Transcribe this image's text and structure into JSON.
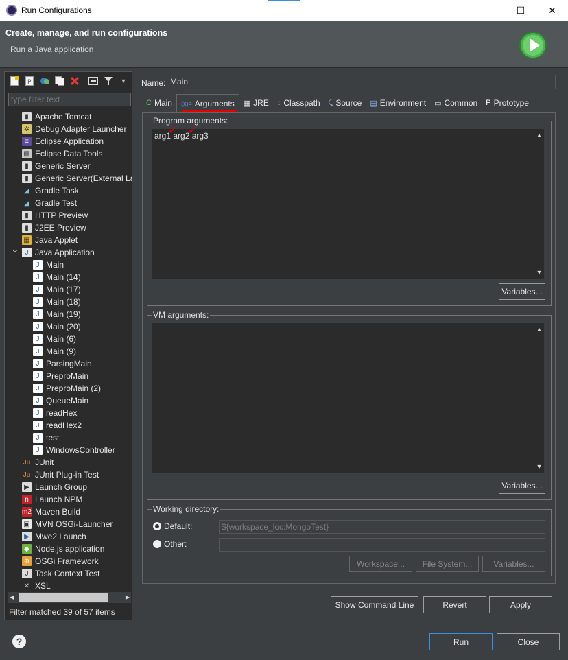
{
  "window": {
    "title": "Run Configurations",
    "minimize_glyph": "—",
    "maximize_glyph": "☐",
    "close_glyph": "✕"
  },
  "banner": {
    "title": "Create, manage, and run configurations",
    "subtitle": "Run a Java application"
  },
  "filter": {
    "placeholder": "type filter text"
  },
  "tree": [
    {
      "label": "Apache Tomcat",
      "icon": "tomcat-icon",
      "level": 0
    },
    {
      "label": "Debug Adapter Launcher",
      "icon": "debug-adapter-icon",
      "level": 0
    },
    {
      "label": "Eclipse Application",
      "icon": "eclipse-icon",
      "level": 0
    },
    {
      "label": "Eclipse Data Tools",
      "icon": "database-icon",
      "level": 0
    },
    {
      "label": "Generic Server",
      "icon": "server-icon",
      "level": 0
    },
    {
      "label": "Generic Server(External La",
      "icon": "server-icon",
      "level": 0
    },
    {
      "label": "Gradle Task",
      "icon": "gradle-icon",
      "level": 0
    },
    {
      "label": "Gradle Test",
      "icon": "gradle-icon",
      "level": 0
    },
    {
      "label": "HTTP Preview",
      "icon": "server-icon",
      "level": 0
    },
    {
      "label": "J2EE Preview",
      "icon": "server-icon",
      "level": 0
    },
    {
      "label": "Java Applet",
      "icon": "applet-icon",
      "level": 0
    },
    {
      "label": "Java Application",
      "icon": "java-app-icon",
      "level": 0,
      "expanded": true
    },
    {
      "label": "Main",
      "icon": "java-config-icon",
      "level": 1
    },
    {
      "label": "Main (14)",
      "icon": "java-config-icon",
      "level": 1
    },
    {
      "label": "Main (17)",
      "icon": "java-config-icon",
      "level": 1
    },
    {
      "label": "Main (18)",
      "icon": "java-config-icon",
      "level": 1
    },
    {
      "label": "Main (19)",
      "icon": "java-config-icon",
      "level": 1
    },
    {
      "label": "Main (20)",
      "icon": "java-config-icon",
      "level": 1
    },
    {
      "label": "Main (6)",
      "icon": "java-config-icon",
      "level": 1
    },
    {
      "label": "Main (9)",
      "icon": "java-config-icon",
      "level": 1
    },
    {
      "label": "ParsingMain",
      "icon": "java-config-icon",
      "level": 1
    },
    {
      "label": "PreproMain",
      "icon": "java-config-icon",
      "level": 1
    },
    {
      "label": "PreproMain (2)",
      "icon": "java-config-icon",
      "level": 1
    },
    {
      "label": "QueueMain",
      "icon": "java-config-icon",
      "level": 1
    },
    {
      "label": "readHex",
      "icon": "java-config-icon",
      "level": 1
    },
    {
      "label": "readHex2",
      "icon": "java-config-icon",
      "level": 1
    },
    {
      "label": "test",
      "icon": "java-config-icon",
      "level": 1
    },
    {
      "label": "WindowsController",
      "icon": "java-config-icon",
      "level": 1
    },
    {
      "label": "JUnit",
      "icon": "junit-icon",
      "level": 0
    },
    {
      "label": "JUnit Plug-in Test",
      "icon": "junit-icon",
      "level": 0
    },
    {
      "label": "Launch Group",
      "icon": "launch-group-icon",
      "level": 0
    },
    {
      "label": "Launch NPM",
      "icon": "npm-icon",
      "level": 0
    },
    {
      "label": "Maven Build",
      "icon": "maven-icon",
      "level": 0
    },
    {
      "label": "MVN OSGi-Launcher",
      "icon": "osgi-launcher-icon",
      "level": 0
    },
    {
      "label": "Mwe2 Launch",
      "icon": "mwe2-icon",
      "level": 0
    },
    {
      "label": "Node.js application",
      "icon": "nodejs-icon",
      "level": 0
    },
    {
      "label": "OSGi Framework",
      "icon": "osgi-icon",
      "level": 0
    },
    {
      "label": "Task Context Test",
      "icon": "task-context-icon",
      "level": 0
    },
    {
      "label": "XSL",
      "icon": "xsl-icon",
      "level": 0
    }
  ],
  "filter_status": "Filter matched 39 of 57 items",
  "name": {
    "label": "Name:",
    "value": "Main"
  },
  "tabs": [
    {
      "label": "Main",
      "icon": "main-tab-icon"
    },
    {
      "label": "Arguments",
      "icon": "arguments-tab-icon",
      "active": true
    },
    {
      "label": "JRE",
      "icon": "jre-tab-icon"
    },
    {
      "label": "Classpath",
      "icon": "classpath-tab-icon"
    },
    {
      "label": "Source",
      "icon": "source-tab-icon"
    },
    {
      "label": "Environment",
      "icon": "environment-tab-icon"
    },
    {
      "label": "Common",
      "icon": "common-tab-icon"
    },
    {
      "label": "Prototype",
      "icon": "prototype-tab-icon"
    }
  ],
  "program_args": {
    "label": "Program arguments:",
    "value": "arg1 arg2 arg3",
    "variables_button": "Variables..."
  },
  "vm_args": {
    "label": "VM arguments:",
    "value": "",
    "variables_button": "Variables..."
  },
  "working_dir": {
    "label": "Working directory:",
    "default_label": "Default:",
    "default_value": "${workspace_loc:MongoTest}",
    "other_label": "Other:",
    "other_value": "",
    "workspace_button": "Workspace...",
    "filesystem_button": "File System...",
    "variables_button": "Variables..."
  },
  "actions": {
    "show_command_line": "Show Command Line",
    "revert": "Revert",
    "apply": "Apply",
    "run": "Run",
    "close": "Close"
  },
  "colors": {
    "annotation": "#e60000",
    "background": "#3c3f41",
    "run_green": "#5cb85c"
  }
}
